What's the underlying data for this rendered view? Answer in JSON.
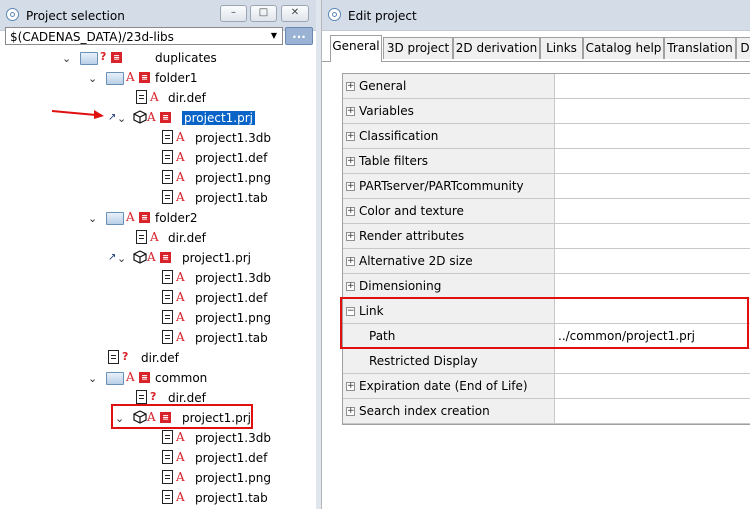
{
  "left_panel": {
    "title": "Project selection",
    "path_combo": "$(CADENAS_DATA)/23d-libs",
    "more_button": "...",
    "win_min": "–",
    "win_restore": "□",
    "win_close": "✕"
  },
  "tree": [
    {
      "label": "duplicates"
    },
    {
      "label": "folder1"
    },
    {
      "label": "dir.def"
    },
    {
      "label": "project1.prj"
    },
    {
      "label": "project1.3db"
    },
    {
      "label": "project1.def"
    },
    {
      "label": "project1.png"
    },
    {
      "label": "project1.tab"
    },
    {
      "label": "folder2"
    },
    {
      "label": "dir.def"
    },
    {
      "label": "project1.prj"
    },
    {
      "label": "project1.3db"
    },
    {
      "label": "project1.def"
    },
    {
      "label": "project1.png"
    },
    {
      "label": "project1.tab"
    },
    {
      "label": "dir.def"
    },
    {
      "label": "common"
    },
    {
      "label": "dir.def"
    },
    {
      "label": "project1.prj"
    },
    {
      "label": "project1.3db"
    },
    {
      "label": "project1.def"
    },
    {
      "label": "project1.png"
    },
    {
      "label": "project1.tab"
    }
  ],
  "right_panel": {
    "title": "Edit project",
    "tabs": [
      "General",
      "3D project",
      "2D derivation",
      "Links",
      "Catalog help",
      "Translation",
      "D"
    ]
  },
  "properties": [
    {
      "label": "General",
      "value": ""
    },
    {
      "label": "Variables",
      "value": ""
    },
    {
      "label": "Classification",
      "value": ""
    },
    {
      "label": "Table filters",
      "value": ""
    },
    {
      "label": "PARTserver/PARTcommunity",
      "value": ""
    },
    {
      "label": "Color and texture",
      "value": ""
    },
    {
      "label": "Render attributes",
      "value": ""
    },
    {
      "label": "Alternative 2D size",
      "value": ""
    },
    {
      "label": "Dimensioning",
      "value": ""
    },
    {
      "label": "Link",
      "value": ""
    },
    {
      "label": "Path",
      "value": "../common/project1.prj"
    },
    {
      "label": "Restricted Display",
      "value": ""
    },
    {
      "label": "Expiration date (End of Life)",
      "value": ""
    },
    {
      "label": "Search index creation",
      "value": ""
    }
  ],
  "colors": {
    "highlight": "#e01010",
    "selection": "#0a64c8",
    "accent_red": "#d8232a"
  },
  "icons": {
    "expanded": "chevron-down-icon",
    "folder": "folder-open-icon",
    "file": "document-icon",
    "project": "cube-icon",
    "link": "link-arrow-icon"
  }
}
